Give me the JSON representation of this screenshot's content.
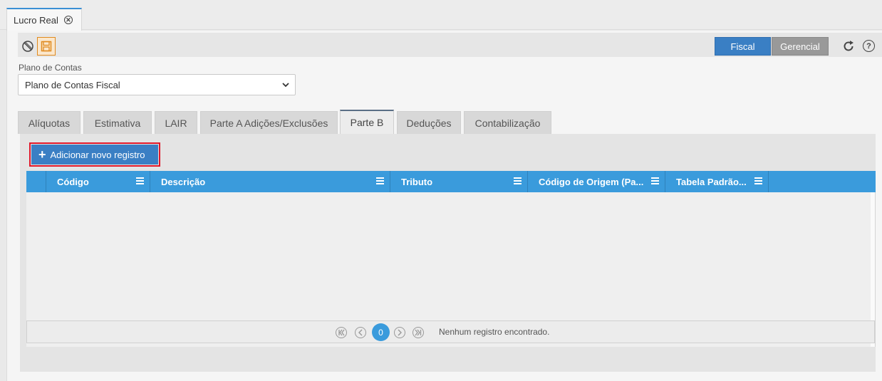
{
  "window": {
    "tab_title": "Lucro Real"
  },
  "toolbar": {
    "icons": [
      "block-icon",
      "save-icon",
      "refresh-icon",
      "help-icon"
    ],
    "view_modes": [
      {
        "label": "Fiscal",
        "active": true
      },
      {
        "label": "Gerencial",
        "active": false
      }
    ],
    "help_glyph": "?"
  },
  "form": {
    "plano_label": "Plano de Contas",
    "plano_value": "Plano de Contas Fiscal"
  },
  "tabs": [
    {
      "label": "Alíquotas",
      "active": false
    },
    {
      "label": "Estimativa",
      "active": false
    },
    {
      "label": "LAIR",
      "active": false
    },
    {
      "label": "Parte A Adições/Exclusões",
      "active": false
    },
    {
      "label": "Parte B",
      "active": true
    },
    {
      "label": "Deduções",
      "active": false
    },
    {
      "label": "Contabilização",
      "active": false
    }
  ],
  "actions": {
    "add_label": "Adicionar novo registro"
  },
  "grid": {
    "columns": [
      "Código",
      "Descrição",
      "Tributo",
      "Código de Origem (Pa...",
      "Tabela Padrão..."
    ],
    "rows": []
  },
  "pager": {
    "current_page": "0",
    "status": "Nenhum registro encontrado."
  },
  "colors": {
    "accent": "#3a7fc4",
    "grid_header": "#3a9bdc",
    "highlight": "#e0182a",
    "save_icon": "#e08a1e"
  }
}
